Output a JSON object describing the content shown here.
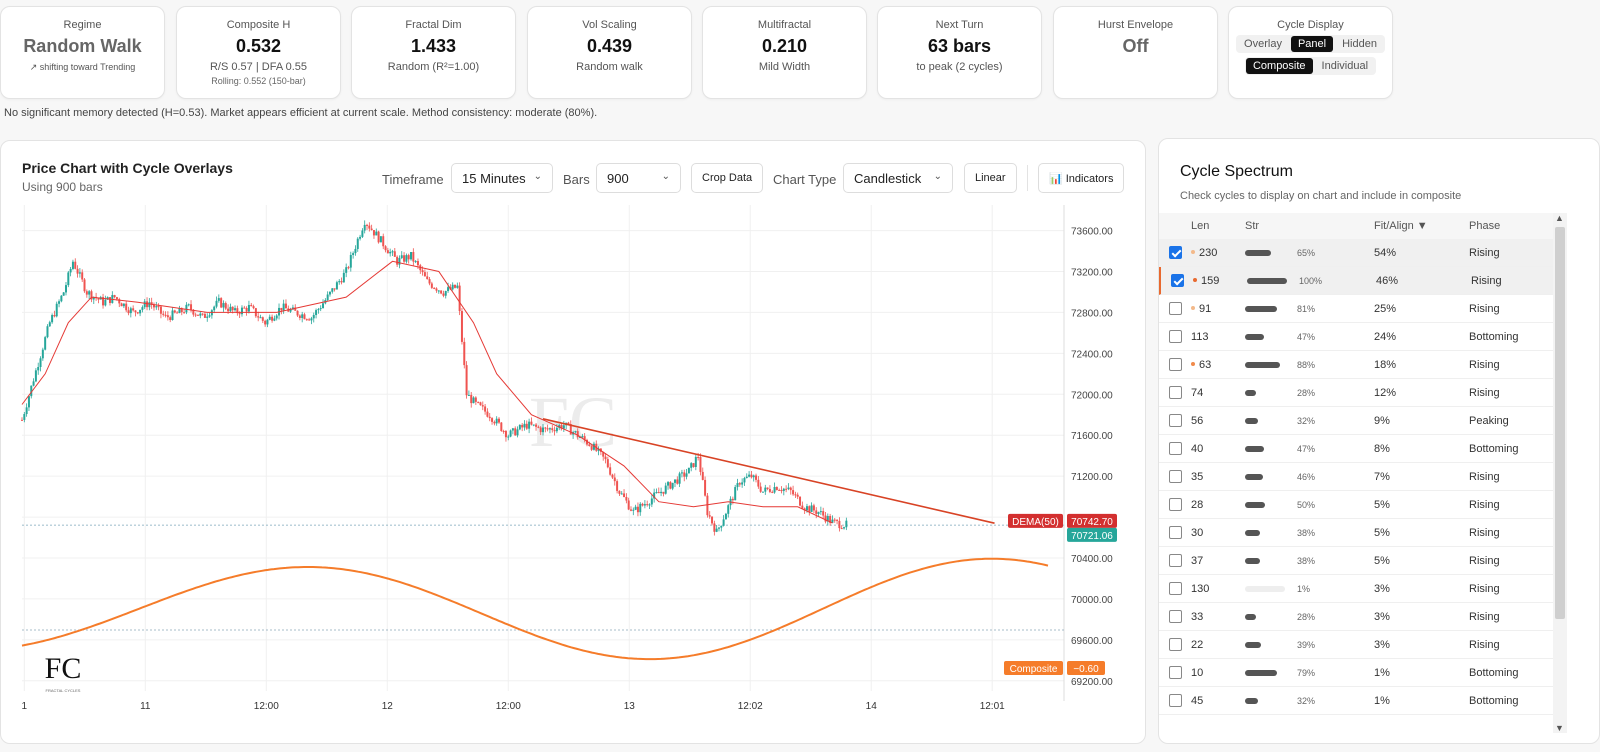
{
  "cards": [
    {
      "label": "Regime",
      "value": "Random Walk",
      "hint": "↗ shifting toward Trending"
    },
    {
      "label": "Composite H",
      "value": "0.532",
      "sub": "R/S 0.57 | DFA 0.55",
      "sub2": "Rolling: 0.552 (150-bar)"
    },
    {
      "label": "Fractal Dim",
      "value": "1.433",
      "sub": "Random (R²=1.00)"
    },
    {
      "label": "Vol Scaling",
      "value": "0.439",
      "sub": "Random walk"
    },
    {
      "label": "Multifractal",
      "value": "0.210",
      "sub": "Mild Width"
    },
    {
      "label": "Next Turn",
      "value": "63 bars",
      "sub": "to peak (2 cycles)"
    },
    {
      "label": "Hurst Envelope",
      "value": "Off"
    },
    {
      "label": "Cycle Display",
      "modes": [
        "Overlay",
        "Panel",
        "Hidden"
      ],
      "active_mode": "Panel",
      "views": [
        "Composite",
        "Individual"
      ],
      "active_view": "Composite"
    }
  ],
  "notice": "No significant memory detected (H=0.53). Market appears efficient at current scale. Method consistency: moderate (80%).",
  "chart": {
    "title": "Price Chart with Cycle Overlays",
    "subtitle": "Using 900 bars",
    "timeframe_label": "Timeframe",
    "timeframe_value": "15 Minutes",
    "bars_label": "Bars",
    "bars_value": "900",
    "crop_label": "Crop Data",
    "chart_type_label": "Chart Type",
    "chart_type_value": "Candlestick",
    "scale_label": "Linear",
    "indicators_label": "📊 Indicators",
    "watermark": "FC",
    "logo_text": "FC",
    "logo_caption": "FRACTAL CYCLES",
    "dema_label": "DEMA(50)",
    "dema_value": "70742.70",
    "price_value": "70721.06",
    "composite_label": "Composite",
    "composite_value": "−0.60",
    "colors": {
      "up": "#26a69a",
      "down": "#ef5350",
      "dema": "#e53935",
      "cycle": "#f57c2a",
      "trend": "#d84325"
    }
  },
  "chart_data": {
    "type": "candlestick",
    "y_ticks": [
      "73600.00",
      "73200.00",
      "72800.00",
      "72400.00",
      "72000.00",
      "71600.00",
      "71200.00",
      "70800.00",
      "70400.00",
      "70000.00",
      "69600.00",
      "69200.00"
    ],
    "x_ticks": [
      "1",
      "11",
      "12:00",
      "12",
      "12:00",
      "13",
      "12:02",
      "14",
      "12:01"
    ],
    "ylim": [
      69100,
      73850
    ],
    "price_path": [
      [
        0,
        71750
      ],
      [
        5,
        72150
      ],
      [
        12,
        72700
      ],
      [
        18,
        73000
      ],
      [
        22,
        73300
      ],
      [
        28,
        73000
      ],
      [
        35,
        72900
      ],
      [
        40,
        72950
      ],
      [
        48,
        72800
      ],
      [
        55,
        72900
      ],
      [
        62,
        72750
      ],
      [
        68,
        72800
      ],
      [
        72,
        72850
      ],
      [
        78,
        72750
      ],
      [
        85,
        72900
      ],
      [
        92,
        72800
      ],
      [
        98,
        72850
      ],
      [
        105,
        72700
      ],
      [
        112,
        72850
      ],
      [
        118,
        72800
      ],
      [
        125,
        72750
      ],
      [
        132,
        72950
      ],
      [
        140,
        73200
      ],
      [
        148,
        73700
      ],
      [
        155,
        73500
      ],
      [
        162,
        73300
      ],
      [
        168,
        73350
      ],
      [
        175,
        73100
      ],
      [
        182,
        73000
      ],
      [
        188,
        73050
      ],
      [
        192,
        72000
      ],
      [
        196,
        71900
      ],
      [
        202,
        71800
      ],
      [
        210,
        71600
      ],
      [
        218,
        71700
      ],
      [
        226,
        71650
      ],
      [
        234,
        71700
      ],
      [
        240,
        71600
      ],
      [
        246,
        71500
      ],
      [
        252,
        71350
      ],
      [
        258,
        71050
      ],
      [
        264,
        70850
      ],
      [
        270,
        70950
      ],
      [
        276,
        71050
      ],
      [
        282,
        71150
      ],
      [
        288,
        71250
      ],
      [
        292,
        71400
      ],
      [
        296,
        70850
      ],
      [
        300,
        70650
      ],
      [
        305,
        70900
      ],
      [
        310,
        71150
      ],
      [
        315,
        71200
      ],
      [
        320,
        71050
      ],
      [
        326,
        71100
      ],
      [
        332,
        71050
      ],
      [
        338,
        70900
      ],
      [
        344,
        70850
      ],
      [
        350,
        70750
      ],
      [
        356,
        70721
      ]
    ],
    "dema_path": [
      [
        0,
        71900
      ],
      [
        10,
        72200
      ],
      [
        20,
        72700
      ],
      [
        30,
        72950
      ],
      [
        50,
        72900
      ],
      [
        80,
        72800
      ],
      [
        110,
        72800
      ],
      [
        140,
        72950
      ],
      [
        160,
        73300
      ],
      [
        180,
        73200
      ],
      [
        195,
        72700
      ],
      [
        205,
        72200
      ],
      [
        220,
        71800
      ],
      [
        240,
        71600
      ],
      [
        260,
        71300
      ],
      [
        275,
        70950
      ],
      [
        290,
        70900
      ],
      [
        305,
        70950
      ],
      [
        320,
        70900
      ],
      [
        335,
        70900
      ],
      [
        350,
        70742
      ]
    ],
    "trendline": [
      [
        225,
        71760
      ],
      [
        420,
        70740
      ]
    ],
    "composite_cycle": {
      "amplitude": 0.6,
      "period_bars": 230,
      "current": -0.6
    },
    "dema_current": 70742.7,
    "last_price": 70721.06
  },
  "spectrum": {
    "title": "Cycle Spectrum",
    "subtitle": "Check cycles to display on chart and include in composite",
    "headers": {
      "len": "Len",
      "str": "Str",
      "fit": "Fit/Align ▼",
      "phase": "Phase"
    },
    "rows": [
      {
        "len": "230",
        "str": "65%",
        "str_v": 0.65,
        "fit": "54%",
        "phase": "Rising",
        "checked": true,
        "dot": "#f3b98a"
      },
      {
        "len": "159",
        "str": "100%",
        "str_v": 1.0,
        "fit": "46%",
        "phase": "Rising",
        "checked": true,
        "dot": "#e8692f"
      },
      {
        "len": "91",
        "str": "81%",
        "str_v": 0.81,
        "fit": "25%",
        "phase": "Rising",
        "checked": false,
        "dot": "#f3b98a"
      },
      {
        "len": "113",
        "str": "47%",
        "str_v": 0.47,
        "fit": "24%",
        "phase": "Bottoming",
        "checked": false,
        "dot": ""
      },
      {
        "len": "63",
        "str": "88%",
        "str_v": 0.88,
        "fit": "18%",
        "phase": "Rising",
        "checked": false,
        "dot": "#f08a4b"
      },
      {
        "len": "74",
        "str": "28%",
        "str_v": 0.28,
        "fit": "12%",
        "phase": "Rising",
        "checked": false,
        "dot": ""
      },
      {
        "len": "56",
        "str": "32%",
        "str_v": 0.32,
        "fit": "9%",
        "phase": "Peaking",
        "checked": false,
        "dot": ""
      },
      {
        "len": "40",
        "str": "47%",
        "str_v": 0.47,
        "fit": "8%",
        "phase": "Bottoming",
        "checked": false,
        "dot": ""
      },
      {
        "len": "35",
        "str": "46%",
        "str_v": 0.46,
        "fit": "7%",
        "phase": "Rising",
        "checked": false,
        "dot": ""
      },
      {
        "len": "28",
        "str": "50%",
        "str_v": 0.5,
        "fit": "5%",
        "phase": "Rising",
        "checked": false,
        "dot": ""
      },
      {
        "len": "30",
        "str": "38%",
        "str_v": 0.38,
        "fit": "5%",
        "phase": "Rising",
        "checked": false,
        "dot": ""
      },
      {
        "len": "37",
        "str": "38%",
        "str_v": 0.38,
        "fit": "5%",
        "phase": "Rising",
        "checked": false,
        "dot": ""
      },
      {
        "len": "130",
        "str": "1%",
        "str_v": 0.01,
        "fit": "3%",
        "phase": "Rising",
        "checked": false,
        "dot": ""
      },
      {
        "len": "33",
        "str": "28%",
        "str_v": 0.28,
        "fit": "3%",
        "phase": "Rising",
        "checked": false,
        "dot": ""
      },
      {
        "len": "22",
        "str": "39%",
        "str_v": 0.39,
        "fit": "3%",
        "phase": "Rising",
        "checked": false,
        "dot": ""
      },
      {
        "len": "10",
        "str": "79%",
        "str_v": 0.79,
        "fit": "1%",
        "phase": "Bottoming",
        "checked": false,
        "dot": ""
      },
      {
        "len": "45",
        "str": "32%",
        "str_v": 0.32,
        "fit": "1%",
        "phase": "Bottoming",
        "checked": false,
        "dot": ""
      }
    ]
  }
}
